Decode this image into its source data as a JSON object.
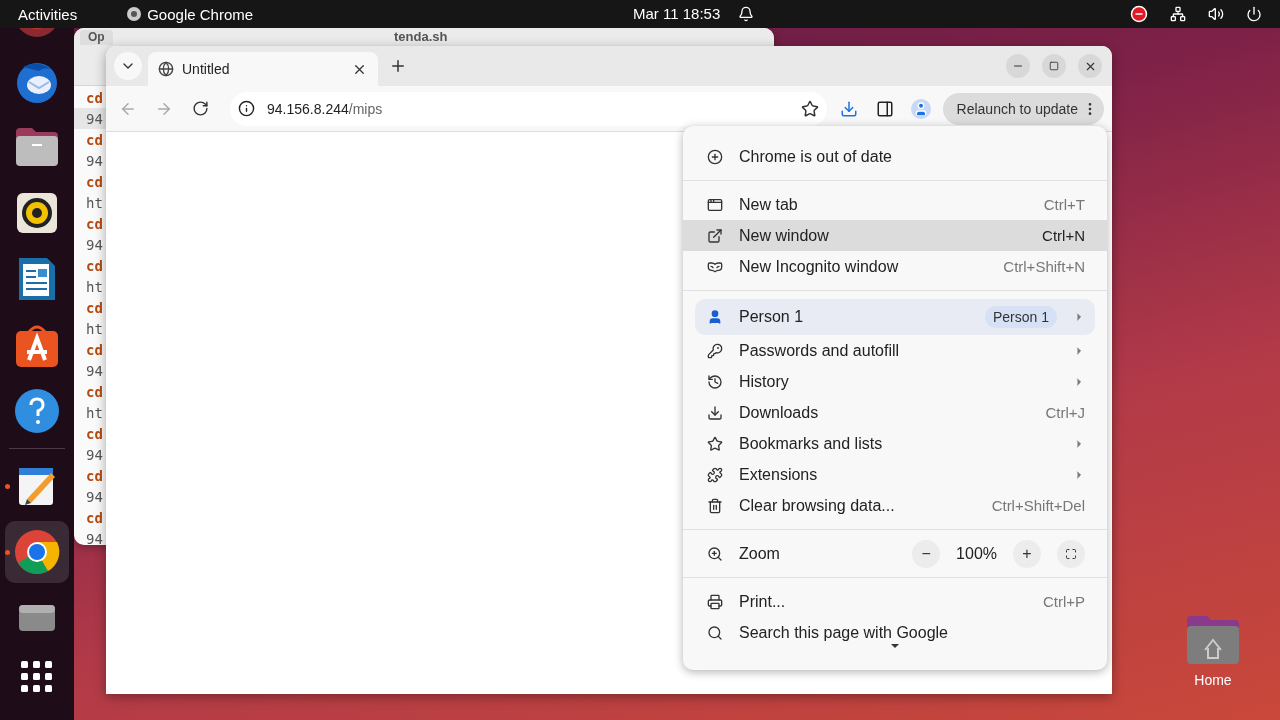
{
  "top_bar": {
    "activities": "Activities",
    "app_name": "Google Chrome",
    "clock": "Mar 11  18:53"
  },
  "dock": {
    "items": [
      {
        "running": false,
        "selected": false
      },
      {
        "running": false,
        "selected": false
      },
      {
        "running": false,
        "selected": false
      },
      {
        "running": false,
        "selected": false
      },
      {
        "running": false,
        "selected": false
      },
      {
        "running": false,
        "selected": false
      },
      {
        "running": false,
        "selected": false
      },
      {
        "running": true,
        "selected": false
      },
      {
        "running": true,
        "selected": true
      },
      {
        "running": false,
        "selected": false
      }
    ]
  },
  "editor_window": {
    "title": "tenda.sh",
    "open_button": "Op",
    "lines": [
      {
        "text": "cd",
        "kind": "keyword",
        "current": false
      },
      {
        "text": "94",
        "kind": "plain",
        "current": true
      },
      {
        "text": "cd",
        "kind": "keyword",
        "current": false
      },
      {
        "text": "94",
        "kind": "plain",
        "current": false
      },
      {
        "text": "cd",
        "kind": "keyword",
        "current": false
      },
      {
        "text": "ht",
        "kind": "plain",
        "current": false
      },
      {
        "text": "cd",
        "kind": "keyword",
        "current": false
      },
      {
        "text": "94",
        "kind": "plain",
        "current": false
      },
      {
        "text": "cd",
        "kind": "keyword",
        "current": false
      },
      {
        "text": "ht",
        "kind": "plain",
        "current": false
      },
      {
        "text": "cd",
        "kind": "keyword",
        "current": false
      },
      {
        "text": "ht",
        "kind": "plain",
        "current": false
      },
      {
        "text": "cd",
        "kind": "keyword",
        "current": false
      },
      {
        "text": "94",
        "kind": "plain",
        "current": false
      },
      {
        "text": "cd",
        "kind": "keyword",
        "current": false
      },
      {
        "text": "ht",
        "kind": "plain",
        "current": false
      },
      {
        "text": "cd",
        "kind": "keyword",
        "current": false
      },
      {
        "text": "94",
        "kind": "plain",
        "current": false
      },
      {
        "text": "cd",
        "kind": "keyword",
        "current": false
      },
      {
        "text": "94",
        "kind": "plain",
        "current": false
      },
      {
        "text": "cd",
        "kind": "keyword",
        "current": false
      },
      {
        "text": "94",
        "kind": "plain",
        "current": false
      }
    ]
  },
  "browser": {
    "tab": {
      "title": "Untitled"
    },
    "address": {
      "host": "94.156.8.244",
      "path": "/mips"
    },
    "relaunch_button": "Relaunch to update",
    "menu": {
      "sections": [
        [
          {
            "kind": "item",
            "label": "Chrome is out of date",
            "highlighted": false,
            "submenu": false
          }
        ],
        [
          {
            "kind": "item",
            "label": "New tab",
            "shortcut": "Ctrl+T",
            "highlighted": false,
            "submenu": false
          },
          {
            "kind": "item",
            "label": "New window",
            "shortcut": "Ctrl+N",
            "highlighted": true,
            "submenu": false
          },
          {
            "kind": "item",
            "label": "New Incognito window",
            "shortcut": "Ctrl+Shift+N",
            "highlighted": false,
            "submenu": false
          }
        ],
        [
          {
            "kind": "profile",
            "label": "Person 1",
            "badge": "Person 1",
            "highlighted": false,
            "submenu": true
          },
          {
            "kind": "item",
            "label": "Passwords and autofill",
            "highlighted": false,
            "submenu": true
          },
          {
            "kind": "item",
            "label": "History",
            "highlighted": false,
            "submenu": true
          },
          {
            "kind": "item",
            "label": "Downloads",
            "shortcut": "Ctrl+J",
            "highlighted": false,
            "submenu": false
          },
          {
            "kind": "item",
            "label": "Bookmarks and lists",
            "highlighted": false,
            "submenu": true
          },
          {
            "kind": "item",
            "label": "Extensions",
            "highlighted": false,
            "submenu": true
          },
          {
            "kind": "item",
            "label": "Clear browsing data...",
            "shortcut": "Ctrl+Shift+Del",
            "highlighted": false,
            "submenu": false
          }
        ],
        [
          {
            "kind": "zoom",
            "label": "Zoom",
            "minus": "−",
            "value": "100%",
            "plus": "+",
            "highlighted": false,
            "submenu": false
          }
        ],
        [
          {
            "kind": "item",
            "label": "Print...",
            "shortcut": "Ctrl+P",
            "highlighted": false,
            "submenu": false
          },
          {
            "kind": "item",
            "label": "Search this page with Google",
            "highlighted": false,
            "submenu": false
          }
        ]
      ]
    }
  },
  "desktop_icon": {
    "label": "Home"
  }
}
